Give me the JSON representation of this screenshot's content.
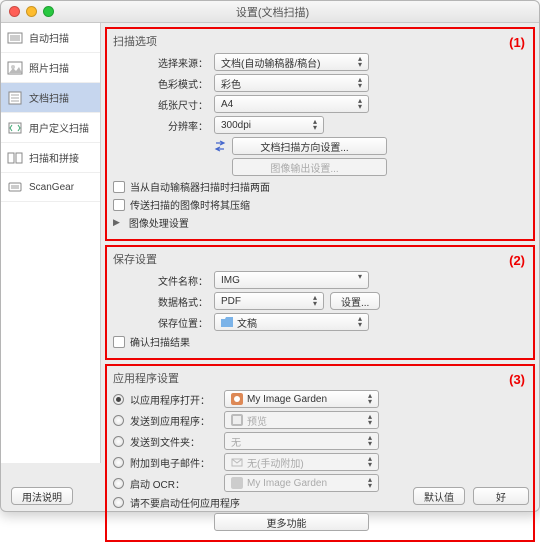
{
  "window": {
    "title": "设置(文档扫描)"
  },
  "sidebar": {
    "items": [
      {
        "label": "自动扫描"
      },
      {
        "label": "照片扫描"
      },
      {
        "label": "文档扫描"
      },
      {
        "label": "用户定义扫描"
      },
      {
        "label": "扫描和拼接"
      },
      {
        "label": "ScanGear"
      }
    ]
  },
  "section1": {
    "title": "扫描选项",
    "num": "(1)",
    "source_label": "选择来源：",
    "source_value": "文档(自动输稿器/稿台)",
    "colormode_label": "色彩模式：",
    "colormode_value": "彩色",
    "papersize_label": "纸张尺寸：",
    "papersize_value": "A4",
    "resolution_label": "分辨率：",
    "resolution_value": "300dpi",
    "orient_btn": "文档扫描方向设置...",
    "output_btn": "图像输出设置...",
    "cb1": "当从自动输稿器扫描时扫描两面",
    "cb2": "传送扫描的图像时将其压缩",
    "disclosure": "图像处理设置"
  },
  "section2": {
    "title": "保存设置",
    "num": "(2)",
    "filename_label": "文件名称：",
    "filename_value": "IMG",
    "format_label": "数据格式：",
    "format_value": "PDF",
    "format_btn": "设置...",
    "savein_label": "保存位置：",
    "savein_value": "文稿",
    "cb": "确认扫描结果"
  },
  "section3": {
    "title": "应用程序设置",
    "num": "(3)",
    "opt1": "以应用程序打开：",
    "opt1_val": "My Image Garden",
    "opt2": "发送到应用程序：",
    "opt2_val": "预览",
    "opt3": "发送到文件夹：",
    "opt3_val": "无",
    "opt4": "附加到电子邮件：",
    "opt4_val": "无(手动附加)",
    "opt5": "启动 OCR：",
    "opt5_val": "My Image Garden",
    "opt6": "请不要启动任何应用程序",
    "more_btn": "更多功能"
  },
  "footer": {
    "instructions": "用法说明",
    "defaults": "默认值",
    "ok": "好"
  }
}
